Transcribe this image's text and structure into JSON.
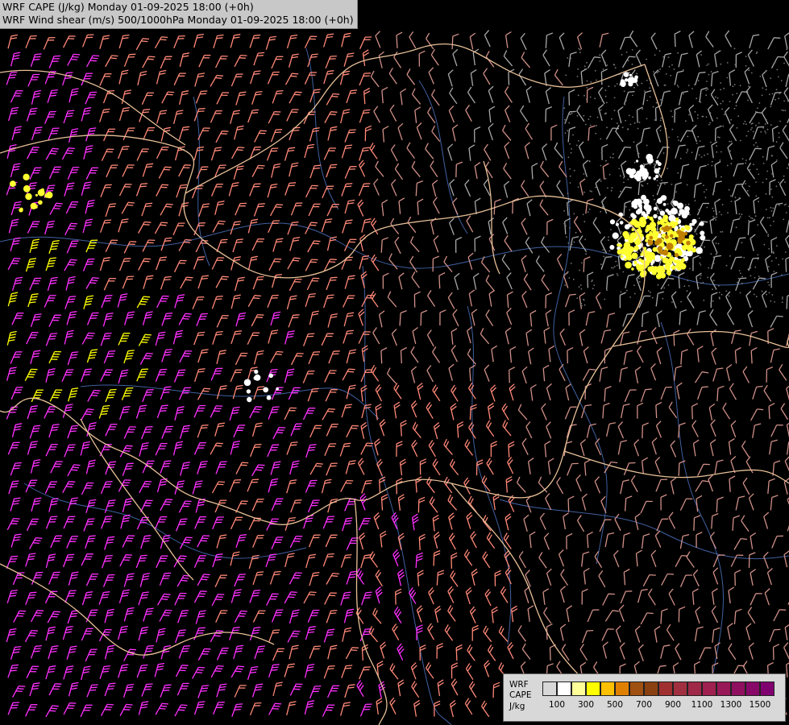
{
  "title": {
    "line1": "WRF CAPE (J/kg) Monday 01-09-2025 18:00 (+0h)",
    "line2": "WRF Wind shear (m/s) 500/1000hPa Monday 01-09-2025 18:00 (+0h)"
  },
  "legend": {
    "label1": "WRF",
    "label2": "CAPE",
    "label3": "J/kg",
    "swatch_colors": [
      "#d8d8d8",
      "#ffffff",
      "#ffff99",
      "#ffff00",
      "#ffc000",
      "#e08000",
      "#a05010",
      "#8a4010",
      "#a03030",
      "#a03040",
      "#a02848",
      "#a02050",
      "#981858",
      "#901060",
      "#880868",
      "#800070"
    ],
    "ticks": [
      "100",
      "300",
      "500",
      "700",
      "900",
      "1100",
      "1300",
      "1500"
    ]
  },
  "map": {
    "icons": [
      "wind-barb-icon",
      "cape-contour-icon",
      "border-line-icon",
      "river-line-icon"
    ],
    "colors": {
      "background": "#000000",
      "barb_gray": "#a8a8a8",
      "barb_pink_light": "#d09088",
      "barb_salmon": "#ff8878",
      "barb_magenta": "#ff30ff",
      "barb_yellow": "#ffff00",
      "border": "#e8c098",
      "river": "#4060a0",
      "cape_yellow": "#ffff30",
      "cape_white": "#ffffff"
    }
  }
}
